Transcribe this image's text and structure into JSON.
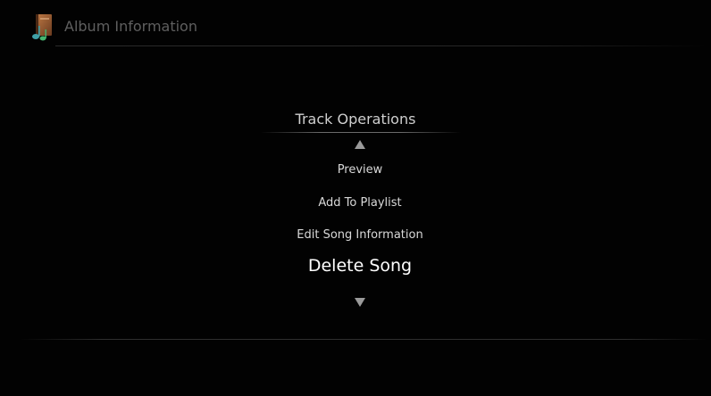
{
  "header": {
    "title": "Album Information",
    "icon": "music-album-icon"
  },
  "menu": {
    "title": "Track Operations",
    "items": [
      {
        "label": "Preview",
        "selected": false
      },
      {
        "label": "Add To Playlist",
        "selected": false
      },
      {
        "label": "Edit Song Information",
        "selected": false
      },
      {
        "label": "Delete Song",
        "selected": true
      }
    ],
    "scroll_up_icon": "triangle-up-icon",
    "scroll_down_icon": "triangle-down-icon"
  },
  "colors": {
    "background": "#020202",
    "header_text": "#5f5f5f",
    "item_text": "#d9d9d9",
    "selected_text": "#ffffff"
  }
}
